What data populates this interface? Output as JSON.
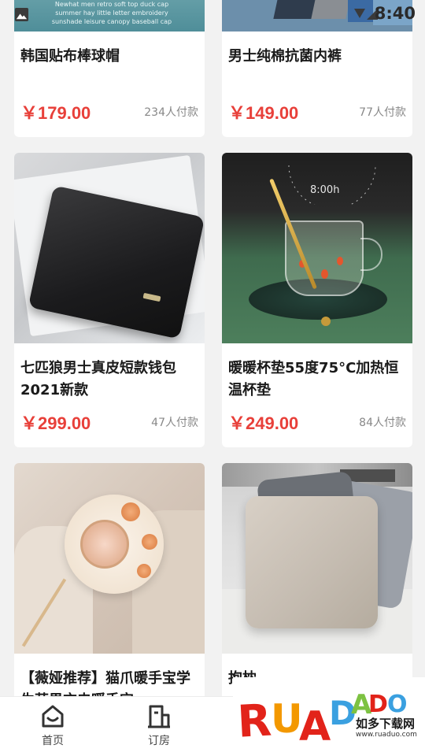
{
  "status_bar": {
    "time": "8:40",
    "image_icon": "image-icon",
    "wifi_icon": "wifi-icon",
    "signal_icon": "signal-icon"
  },
  "products": [
    {
      "title": "韩国贴布棒球帽",
      "price": "￥179.00",
      "sales": "234人付款",
      "photo_text": "Newhat men retro soft top duck cap summer hay little letter embroidery sunshade leisure canopy baseball cap"
    },
    {
      "title": "男士纯棉抗菌内裤",
      "price": "￥149.00",
      "sales": "77人付款"
    },
    {
      "title": "七匹狼男士真皮短款钱包2021新款",
      "price": "￥299.00",
      "sales": "47人付款"
    },
    {
      "title": "暖暖杯垫55度75°C加热恒温杯垫",
      "price": "￥249.00",
      "sales": "84人付款",
      "photo_clock": "8:00h"
    },
    {
      "title": "【薇娅推荐】猫爪暖手宝学生苹果充电暖手宝",
      "price": "",
      "sales": ""
    },
    {
      "title": "抱枕",
      "price": "",
      "sales": ""
    }
  ],
  "tabbar": {
    "home": {
      "label": "首页",
      "icon": "home-icon"
    },
    "booking": {
      "label": "订房",
      "icon": "building-icon"
    }
  },
  "watermark": {
    "logo": "RUANDAO",
    "sub": "如多下载网",
    "url": "www.ruaduo.com"
  },
  "colors": {
    "price": "#e8403a",
    "background": "#f2f2f2",
    "card": "#ffffff"
  }
}
